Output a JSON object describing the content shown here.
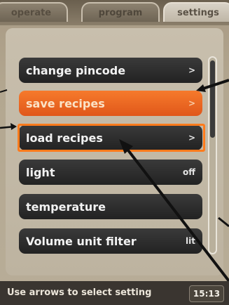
{
  "tabs": [
    {
      "label": "operate"
    },
    {
      "label": "program"
    },
    {
      "label": "settings"
    }
  ],
  "menu": {
    "items": [
      {
        "label": "change pincode",
        "value": ">"
      },
      {
        "label": "save recipes",
        "value": ">"
      },
      {
        "label": "load recipes",
        "value": ">"
      },
      {
        "label": "light",
        "value": "off"
      },
      {
        "label": "temperature",
        "value": ""
      },
      {
        "label": "Volume unit filter",
        "value": "lit"
      }
    ]
  },
  "status": {
    "hint": "Use arrows to select setting",
    "time": "15:13"
  },
  "colors": {
    "active_item": "#f0661f",
    "highlight_frame": "#ff7b1c",
    "item_bg": "#2b2b2b"
  }
}
